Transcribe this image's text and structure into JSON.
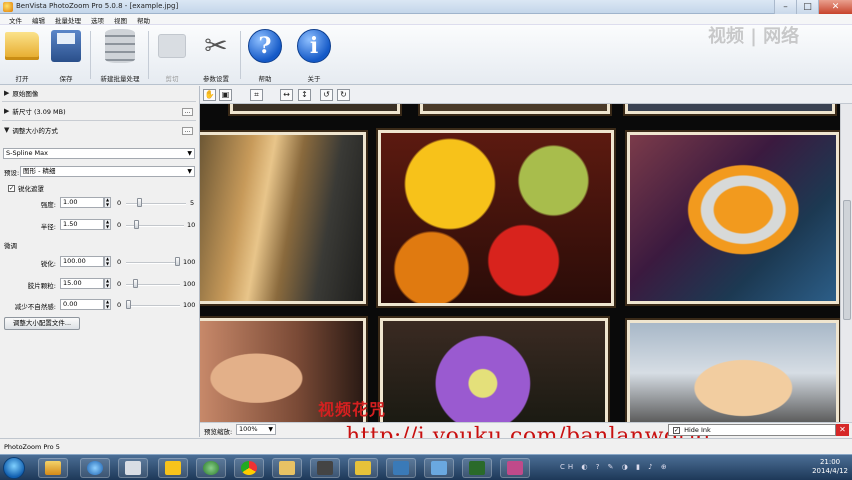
{
  "window": {
    "title": "BenVista PhotoZoom Pro 5.0.8 - [example.jpg]",
    "minimize": "–",
    "maximize": "□",
    "close": "✕"
  },
  "menu": [
    "文件",
    "编辑",
    "批量处理",
    "选项",
    "视图",
    "帮助"
  ],
  "toolbar": {
    "open": "打开",
    "save": "保存",
    "new_batch": "新建批量处理",
    "crop": "剪切",
    "preferences": "参数设置",
    "help": "帮助",
    "about": "关于",
    "help_glyph": "?",
    "about_glyph": "i",
    "tools_glyph": "✂"
  },
  "panel": {
    "original_image": "原始图像",
    "new_size": "新尺寸 (3.09 MB)",
    "resize_method": "调整大小的方式",
    "algorithm": "S-Spline Max",
    "preset_label": "预设:",
    "preset_value": "图形 - 精细",
    "unsharp_mask": "锐化遮罩",
    "unsharp_checked": "✓",
    "strength_label": "强度:",
    "strength_value": "1.00",
    "strength_min": "0",
    "strength_max": "5",
    "strength_level": 0.2,
    "radius_label": "半径:",
    "radius_value": "1.50",
    "radius_min": "0",
    "radius_max": "10",
    "radius_level": 0.15,
    "fine_tune": "微调",
    "sharpness_label": "锐化:",
    "sharpness_value": "100.00",
    "sharpness_min": "0",
    "sharpness_max": "100",
    "sharpness_level": 1.0,
    "grain_label": "胶片颗粒:",
    "grain_value": "15.00",
    "grain_min": "0",
    "grain_max": "100",
    "grain_level": 0.15,
    "artifact_label": "减少不自然感:",
    "artifact_value": "0.00",
    "artifact_min": "0",
    "artifact_max": "100",
    "artifact_level": 0.0,
    "config_button": "调整大小配置文件...",
    "ellipsis": "..."
  },
  "view_tools": {
    "hand": "✋",
    "fit": "▣",
    "crop": "⌗",
    "width": "↔",
    "height": "↕",
    "rotate_left": "↺",
    "rotate_right": "↻"
  },
  "zoom": {
    "label": "预览缩放:",
    "value": "100%"
  },
  "overlay": {
    "cn_watermark": "视频花咒",
    "url": "http://i.youku.com/banlanworld",
    "hide_ink": "Hide Ink",
    "hide_ink_checked": "✓",
    "hide_close": "✕",
    "brand": "视频 | 网络"
  },
  "status": {
    "text": "PhotoZoom Pro 5"
  },
  "taskbar": {
    "tray_symbols": "CH ◐ ? ✎ ◑ ▮ ♪ ⊕",
    "time": "21:00",
    "date": "2014/4/12"
  },
  "colors": {
    "accent": "#1459c7",
    "watermark": "#c81010"
  }
}
